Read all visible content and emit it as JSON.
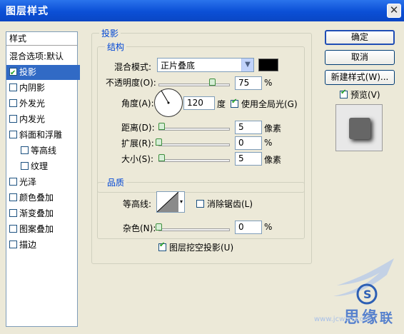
{
  "window": {
    "title": "图层样式",
    "close_glyph": "✕"
  },
  "sidebar": {
    "header": "样式",
    "items": [
      {
        "label": "混合选项:默认",
        "checkbox": false
      },
      {
        "label": "投影",
        "checkbox": true,
        "checked": true,
        "selected": true
      },
      {
        "label": "内阴影",
        "checkbox": true,
        "checked": false
      },
      {
        "label": "外发光",
        "checkbox": true,
        "checked": false
      },
      {
        "label": "内发光",
        "checkbox": true,
        "checked": false
      },
      {
        "label": "斜面和浮雕",
        "checkbox": true,
        "checked": false
      },
      {
        "label": "等高线",
        "checkbox": true,
        "checked": false
      },
      {
        "label": "纹理",
        "checkbox": true,
        "checked": false
      },
      {
        "label": "光泽",
        "checkbox": true,
        "checked": false
      },
      {
        "label": "颜色叠加",
        "checkbox": true,
        "checked": false
      },
      {
        "label": "渐变叠加",
        "checkbox": true,
        "checked": false
      },
      {
        "label": "图案叠加",
        "checkbox": true,
        "checked": false
      },
      {
        "label": "描边",
        "checkbox": true,
        "checked": false
      }
    ]
  },
  "drop_shadow": {
    "group_title": "投影",
    "structure": {
      "title": "结构",
      "blend_mode_label": "混合模式:",
      "blend_mode_value": "正片叠底",
      "blend_color": "#000000",
      "opacity_label": "不透明度(O):",
      "opacity_value": "75",
      "opacity_unit": "%",
      "opacity_fraction": 0.75,
      "angle_label": "角度(A):",
      "angle_value": "120",
      "angle_unit": "度",
      "global_light_label": "使用全局光(G)",
      "global_light_checked": true,
      "distance_label": "距离(D):",
      "distance_value": "5",
      "distance_unit": "像素",
      "spread_label": "扩展(R):",
      "spread_value": "0",
      "spread_unit": "%",
      "size_label": "大小(S):",
      "size_value": "5",
      "size_unit": "像素"
    },
    "quality": {
      "title": "品质",
      "contour_label": "等高线:",
      "antialias_label": "消除锯齿(L)",
      "antialias_checked": false,
      "noise_label": "杂色(N):",
      "noise_value": "0",
      "noise_unit": "%"
    },
    "knockout_label": "图层挖空投影(U)",
    "knockout_checked": true
  },
  "buttons": {
    "ok": "确定",
    "cancel": "取消",
    "new_style": "新建样式(W)...",
    "preview_label": "预览(V)",
    "preview_checked": true
  },
  "watermark": {
    "text": "www.jcwcn.com",
    "color": "#2d5fb4"
  }
}
